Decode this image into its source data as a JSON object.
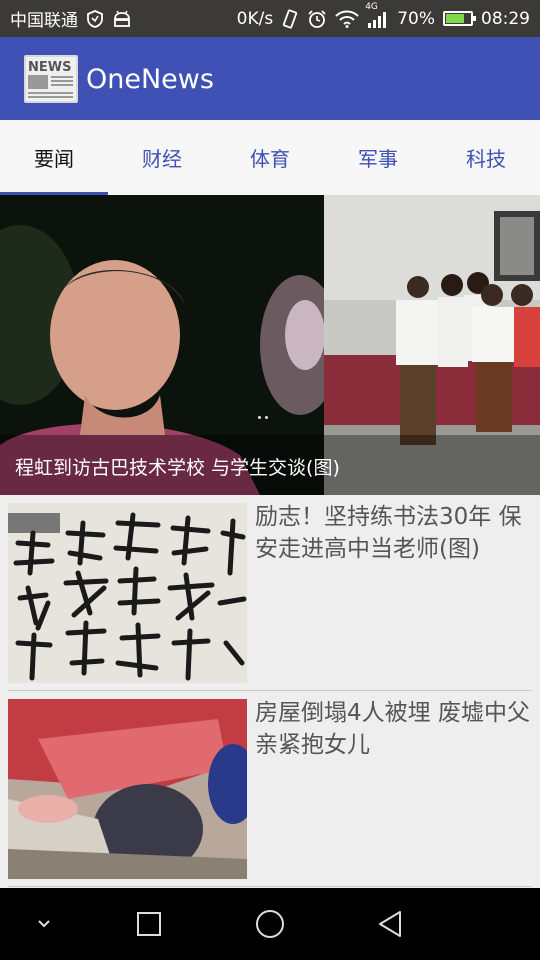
{
  "status_bar": {
    "carrier": "中国联通",
    "net_speed": "0K/s",
    "network_type": "4G",
    "battery": "70%",
    "battery_level": 0.7,
    "time": "08:29"
  },
  "app_bar": {
    "title": "OneNews",
    "logo_text": "NEWS"
  },
  "tabs": [
    {
      "label": "要闻"
    },
    {
      "label": "财经"
    },
    {
      "label": "体育"
    },
    {
      "label": "军事"
    },
    {
      "label": "科技"
    }
  ],
  "banner": {
    "caption": "程虹到访古巴技术学校 与学生交谈(图)"
  },
  "news": [
    {
      "title": "励志！坚持练书法30年 保安走进高中当老师(图)"
    },
    {
      "title": "房屋倒塌4人被埋 废墟中父亲紧抱女儿"
    }
  ],
  "colors": {
    "primary": "#3f51b5",
    "status_bar": "#3b3a36",
    "background": "#eeeeee"
  }
}
